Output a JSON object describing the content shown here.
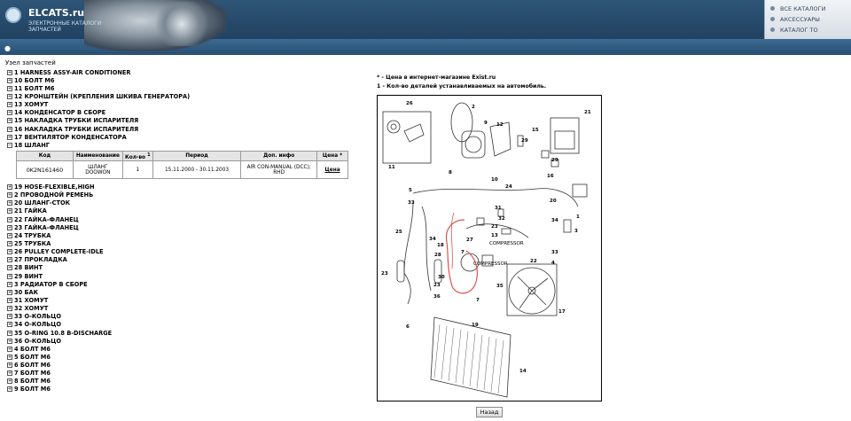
{
  "header": {
    "logo_title": "ELCATS.ru",
    "logo_subtitle": "ЭЛЕКТРОННЫЕ КАТАЛОГИ ЗАПЧАСТЕЙ",
    "nav": [
      {
        "label": "ВСЕ КАТАЛОГИ"
      },
      {
        "label": "АКСЕССУАРЫ"
      },
      {
        "label": "КАТАЛОГ ТО"
      }
    ]
  },
  "breadcrumb": "Узел запчастей",
  "tree_before": [
    "1  HARNESS ASSY-AIR CONDITIONER",
    "10  БОЛТ М6",
    "11  БОЛТ М6",
    "12  КРОНШТЕЙН (КРЕПЛЕНИЯ ШКИВА ГЕНЕРАТОРА)",
    "13  ХОМУТ",
    "14  КОНДЕНСАТОР В СБОРЕ",
    "15  НАКЛАДКА ТРУБКИ ИСПАРИТЕЛЯ",
    "16  НАКЛАДКА ТРУБКИ ИСПАРИТЕЛЯ",
    "17  ВЕНТИЛЯТОР КОНДЕНСАТОРА"
  ],
  "expanded_item": "18  ШЛАНГ",
  "parts_table": {
    "headers": [
      "Код",
      "Наименование",
      "Кол-во",
      "Период",
      "Доп. инфо",
      "Цена *"
    ],
    "row": {
      "code": "0K2N161460",
      "name_line1": "ШЛАНГ",
      "name_line2": "DOOWON",
      "qty": "1",
      "period": "15.11.2000 - 30.11.2003",
      "info_line1": "AIR CON-MANUAL (DCC);",
      "info_line2": "RHD",
      "price": "Цена"
    }
  },
  "tree_after": [
    "19  HOSE-FLEXIBLE,HIGH",
    "2  ПРОВОДНОЙ РЕМЕНЬ",
    "20  ШЛАНГ-СТОК",
    "21  ГАЙКА",
    "22  ГАЙКА-ФЛАНЕЦ",
    "23  ГАЙКА-ФЛАНЕЦ",
    "24  ТРУБКА",
    "25  ТРУБКА",
    "26  PULLEY COMPLETE-IDLE",
    "27  ПРОКЛАДКА",
    "28  ВИНТ",
    "29  ВИНТ",
    "3  РАДИАТОР В СБОРЕ",
    "30  БАК",
    "31  ХОМУТ",
    "32  ХОМУТ",
    "33  О-КОЛЬЦО",
    "34  О-КОЛЬЦО",
    "35  O-RING 10.8 B-DISCHARGE",
    "36  О-КОЛЬЦО",
    "4  БОЛТ М6",
    "5  БОЛТ М6",
    "6  БОЛТ М6",
    "7  БОЛТ М6",
    "8  БОЛТ М6",
    "9  БОЛТ М6"
  ],
  "notes": {
    "price_note": "* - Цена в интернет-магазине Exist.ru",
    "qty_note": "1 - Кол-во деталей устанавливаемых на автомобиль."
  },
  "diagram": {
    "labels": [
      "26",
      "2",
      "9",
      "12",
      "21",
      "11",
      "15",
      "8",
      "10",
      "29",
      "29",
      "16",
      "5",
      "33",
      "31",
      "24",
      "1",
      "20",
      "25",
      "27",
      "23",
      "13",
      "32",
      "34",
      "3",
      "18",
      "34",
      "28",
      "7",
      "22",
      "33",
      "23",
      "4",
      "30",
      "23",
      "36",
      "35",
      "7",
      "17",
      "6",
      "19",
      "14"
    ],
    "compressor_label_1": "COMPRESSOR",
    "compressor_label_2": "COMPRESSOR"
  },
  "back_button": "Назад"
}
